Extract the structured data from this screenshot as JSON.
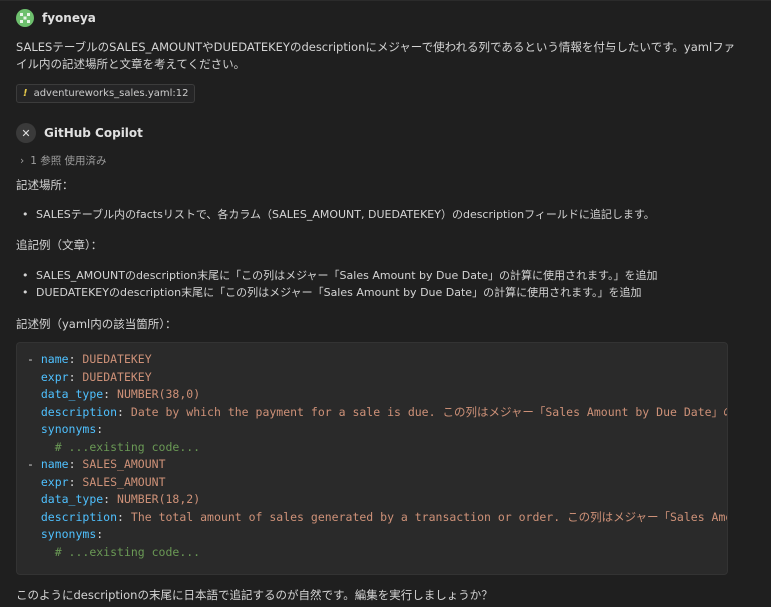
{
  "user": {
    "name": "fyoneya",
    "message": "SALESテーブルのSALES_AMOUNTやDUEDATEKEYのdescriptionにメジャーで使われる列であるという情報を付与したいです。yamlファイル内の記述場所と文章を考えてください。",
    "reference_chip": "adventureworks_sales.yaml:12"
  },
  "assistant": {
    "name": "GitHub Copilot",
    "references_label": "1 参照 使用済み",
    "section1_heading": "記述場所：",
    "section1_bullets": [
      "SALESテーブル内のfactsリストで、各カラム（SALES_AMOUNT, DUEDATEKEY）のdescriptionフィールドに追記します。"
    ],
    "section2_heading": "追記例（文章）：",
    "section2_bullets": [
      "SALES_AMOUNTのdescription末尾に「この列はメジャー「Sales Amount by Due Date」の計算に使用されます。」を追加",
      "DUEDATEKEYのdescription末尾に「この列はメジャー「Sales Amount by Due Date」の計算に使用されます。」を追加"
    ],
    "section3_heading": "記述例（yaml内の該当箇所）：",
    "code": {
      "dash": "- ",
      "block1": {
        "name_key": "name",
        "name_val": "DUEDATEKEY",
        "expr_key": "expr",
        "expr_val": "DUEDATEKEY",
        "type_key": "data_type",
        "type_val": "NUMBER(38,0)",
        "desc_key": "description",
        "desc_val": "Date by which the payment for a sale is due. この列はメジャー「Sales Amount by Due Date」の",
        "syn_key": "synonyms",
        "comment": "# ...existing code..."
      },
      "block2": {
        "name_key": "name",
        "name_val": "SALES_AMOUNT",
        "expr_key": "expr",
        "expr_val": "SALES_AMOUNT",
        "type_key": "data_type",
        "type_val": "NUMBER(18,2)",
        "desc_key": "description",
        "desc_val": "The total amount of sales generated by a transaction or order. この列はメジャー「Sales Amo",
        "syn_key": "synonyms",
        "comment": "# ...existing code..."
      }
    },
    "closing": "このようにdescriptionの末尾に日本語で追記するのが自然です。編集を実行しましょうか？"
  }
}
